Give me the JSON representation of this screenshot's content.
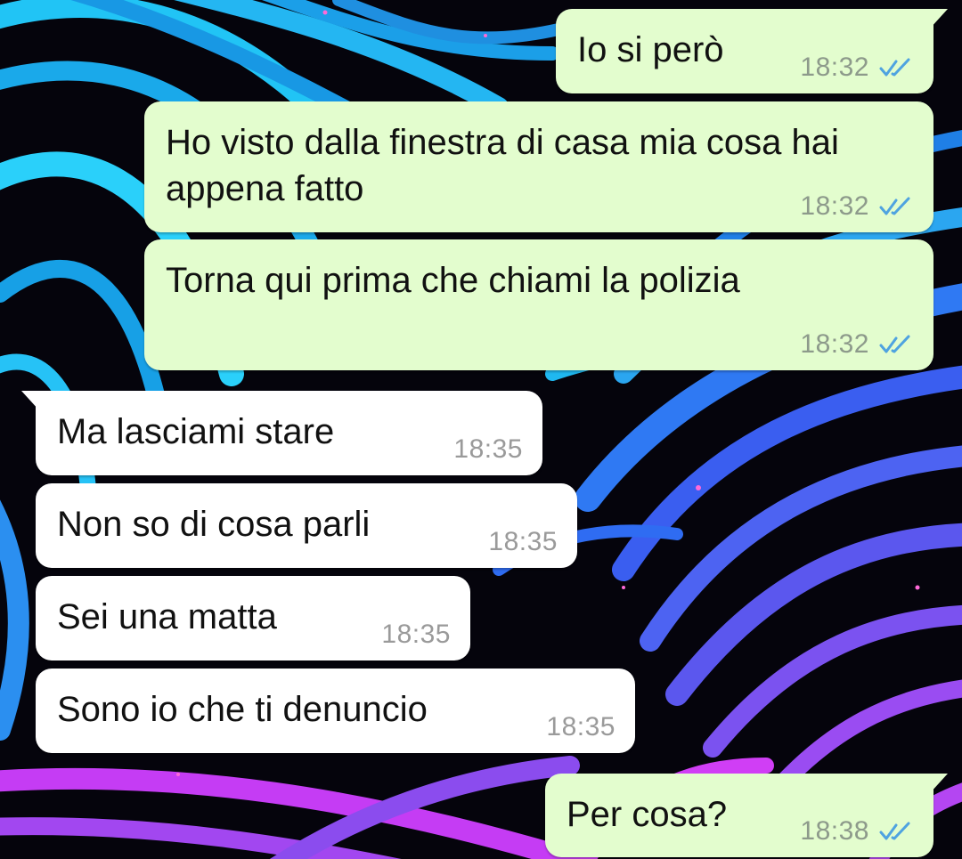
{
  "chat": {
    "messages": [
      {
        "id": "m1",
        "direction": "outgoing",
        "text": "Io si però",
        "time": "18:32",
        "status": "read",
        "status_icon": "double-check-icon"
      },
      {
        "id": "m2",
        "direction": "outgoing",
        "text": "Ho visto dalla finestra di casa mia cosa hai appena fatto",
        "time": "18:32",
        "status": "read",
        "status_icon": "double-check-icon"
      },
      {
        "id": "m3",
        "direction": "outgoing",
        "text": "Torna qui prima che chiami la polizia",
        "time": "18:32",
        "status": "read",
        "status_icon": "double-check-icon"
      },
      {
        "id": "m4",
        "direction": "incoming",
        "text": "Ma lasciami stare",
        "time": "18:35"
      },
      {
        "id": "m5",
        "direction": "incoming",
        "text": "Non so di cosa parli",
        "time": "18:35"
      },
      {
        "id": "m6",
        "direction": "incoming",
        "text": "Sei una matta",
        "time": "18:35"
      },
      {
        "id": "m7",
        "direction": "incoming",
        "text": "Sono io che ti denuncio",
        "time": "18:35"
      },
      {
        "id": "m8",
        "direction": "outgoing",
        "text": "Per cosa?",
        "time": "18:38",
        "status": "read",
        "status_icon": "double-check-icon"
      }
    ]
  },
  "colors": {
    "outgoing_bubble": "#e3fdce",
    "incoming_bubble": "#ffffff",
    "read_check": "#4fa3e0",
    "wallpaper_cyan": "#1fb8f0",
    "wallpaper_blue": "#2f6cf2",
    "wallpaper_purple": "#a54cf0",
    "wallpaper_magenta": "#d23cf5"
  }
}
